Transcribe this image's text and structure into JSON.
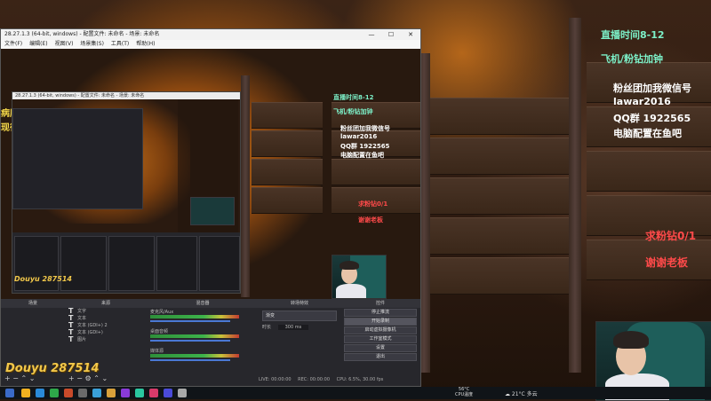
{
  "stream_overlay": {
    "schedule": "直播时间8-12",
    "gift_line": "飞机/粉钻加钟",
    "info_lines": [
      "粉丝团加我微信号",
      "lawar2016",
      "QQ群 1922565",
      "电脑配置在鱼吧"
    ],
    "request": "求粉钻0/1",
    "thanks": "谢谢老板",
    "partial_left": "病历本",
    "partial_left2": "现役最大号"
  },
  "logo": {
    "brand": "Douyu",
    "room": "287514"
  },
  "obs": {
    "title": "28.27.1.3 (64-bit, windows) - 配置文件: 未命名 - 场景: 未命名",
    "menu": [
      "文件(F)",
      "编辑(E)",
      "视图(V)",
      "场景集(S)",
      "工具(T)",
      "帮助(H)"
    ],
    "docks": {
      "scenes": "场景",
      "sources": "来源",
      "mixer": "混音器",
      "transitions": "转场特效",
      "controls": "控件"
    },
    "sources_list": [
      "文字",
      "文本",
      "文本 (GDI+) 2",
      "文本 (GDI+)",
      "图片"
    ],
    "mixer_rows": [
      "麦克风/Aux",
      "桌面音频",
      "媒体源"
    ],
    "transition": {
      "type": "渐变",
      "duration_label": "时长",
      "duration_value": "300 ms"
    },
    "controls": [
      "停止推流",
      "开始录制",
      "启动虚拟摄像机",
      "工作室模式",
      "设置",
      "退出"
    ],
    "status": {
      "live": "LIVE: 00:00:00",
      "rec": "REC: 00:00:00",
      "cpu": "CPU: 6.5%, 30.00 fps"
    }
  },
  "taskbar": {
    "weather_temp": "56°C",
    "weather_label": "CPU温度",
    "temp_right": "21°C",
    "weather_right": "多云"
  }
}
